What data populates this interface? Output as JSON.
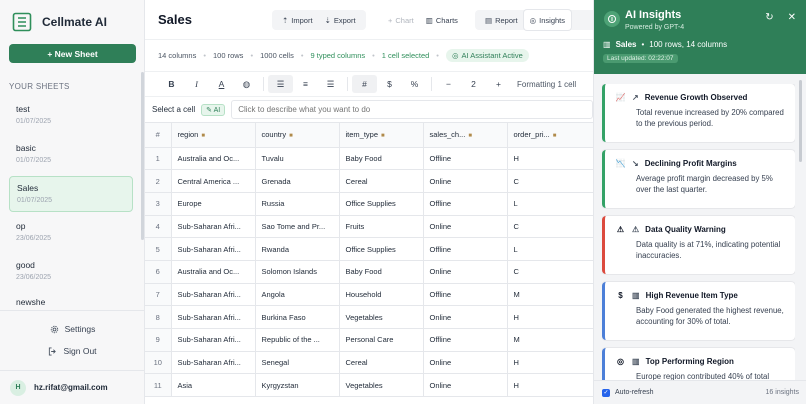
{
  "app": {
    "name": "Cellmate AI",
    "new_sheet_label": "+ New Sheet",
    "section_label": "YOUR SHEETS"
  },
  "sheets": [
    {
      "name": "test",
      "date": "01/07/2025"
    },
    {
      "name": "basic",
      "date": "01/07/2025"
    },
    {
      "name": "Sales",
      "date": "01/07/2025"
    },
    {
      "name": "op",
      "date": "23/06/2025"
    },
    {
      "name": "good",
      "date": "23/06/2025"
    },
    {
      "name": "newshe",
      "date": ""
    }
  ],
  "sidebar_footer": {
    "settings": "Settings",
    "signout": "Sign Out"
  },
  "user": {
    "initial": "H",
    "email": "hz.rifat@gmail.com"
  },
  "toolbar": {
    "title": "Sales",
    "import": "Import",
    "export": "Export",
    "chart": "Chart",
    "charts": "Charts",
    "report": "Report",
    "insights": "Insights"
  },
  "info": {
    "columns": "14 columns",
    "rows": "100 rows",
    "cells": "1000 cells",
    "typed": "9 typed columns",
    "selected": "1 cell selected",
    "assistant": "AI Assistant Active"
  },
  "format": {
    "bold": "B",
    "italic": "I",
    "font_color": "A",
    "hash": "#",
    "dollar": "$",
    "percent": "%",
    "minus": "−",
    "decimals": "2",
    "plus": "+",
    "label": "Formatting 1 cell"
  },
  "cellbar": {
    "select_label": "Select a cell",
    "ai_chip": "✎ AI",
    "placeholder": "Click to describe what you want to do"
  },
  "grid": {
    "headers": [
      "#",
      "region",
      "country",
      "item_type",
      "sales_ch...",
      "order_pri..."
    ],
    "rows": [
      [
        "1",
        "Australia and Oc...",
        "Tuvalu",
        "Baby Food",
        "Offline",
        "H"
      ],
      [
        "2",
        "Central America ...",
        "Grenada",
        "Cereal",
        "Online",
        "C"
      ],
      [
        "3",
        "Europe",
        "Russia",
        "Office Supplies",
        "Offline",
        "L"
      ],
      [
        "4",
        "Sub-Saharan Afri...",
        "Sao Tome and Pr...",
        "Fruits",
        "Online",
        "C"
      ],
      [
        "5",
        "Sub-Saharan Afri...",
        "Rwanda",
        "Office Supplies",
        "Offline",
        "L"
      ],
      [
        "6",
        "Australia and Oc...",
        "Solomon Islands",
        "Baby Food",
        "Online",
        "C"
      ],
      [
        "7",
        "Sub-Saharan Afri...",
        "Angola",
        "Household",
        "Offline",
        "M"
      ],
      [
        "8",
        "Sub-Saharan Afri...",
        "Burkina Faso",
        "Vegetables",
        "Online",
        "H"
      ],
      [
        "9",
        "Sub-Saharan Afri...",
        "Republic of the ...",
        "Personal Care",
        "Offline",
        "M"
      ],
      [
        "10",
        "Sub-Saharan Afri...",
        "Senegal",
        "Cereal",
        "Online",
        "H"
      ],
      [
        "11",
        "Asia",
        "Kyrgyzstan",
        "Vegetables",
        "Online",
        "H"
      ]
    ]
  },
  "panel": {
    "title": "AI Insights",
    "subtitle": "Powered by GPT-4",
    "sheet_name": "Sales",
    "sheet_meta": "100 rows, 14 columns",
    "updated": "Last updated: 02:22:07",
    "cards": [
      {
        "title": "Revenue Growth Observed",
        "body": "Total revenue increased by 20% compared to the previous period.",
        "color": "#34a267"
      },
      {
        "title": "Declining Profit Margins",
        "body": "Average profit margin decreased by 5% over the last quarter.",
        "color": "#34a267"
      },
      {
        "title": "Data Quality Warning",
        "body": "Data quality is at 71%, indicating potential inaccuracies.",
        "color": "#dc4a3e"
      },
      {
        "title": "High Revenue Item Type",
        "body": "Baby Food generated the highest revenue, accounting for 30% of total.",
        "color": "#4c7fd8"
      },
      {
        "title": "Top Performing Region",
        "body": "Europe region contributed 40% of total",
        "color": "#4c7fd8"
      }
    ],
    "auto_refresh": "Auto-refresh",
    "count": "16 insights"
  }
}
